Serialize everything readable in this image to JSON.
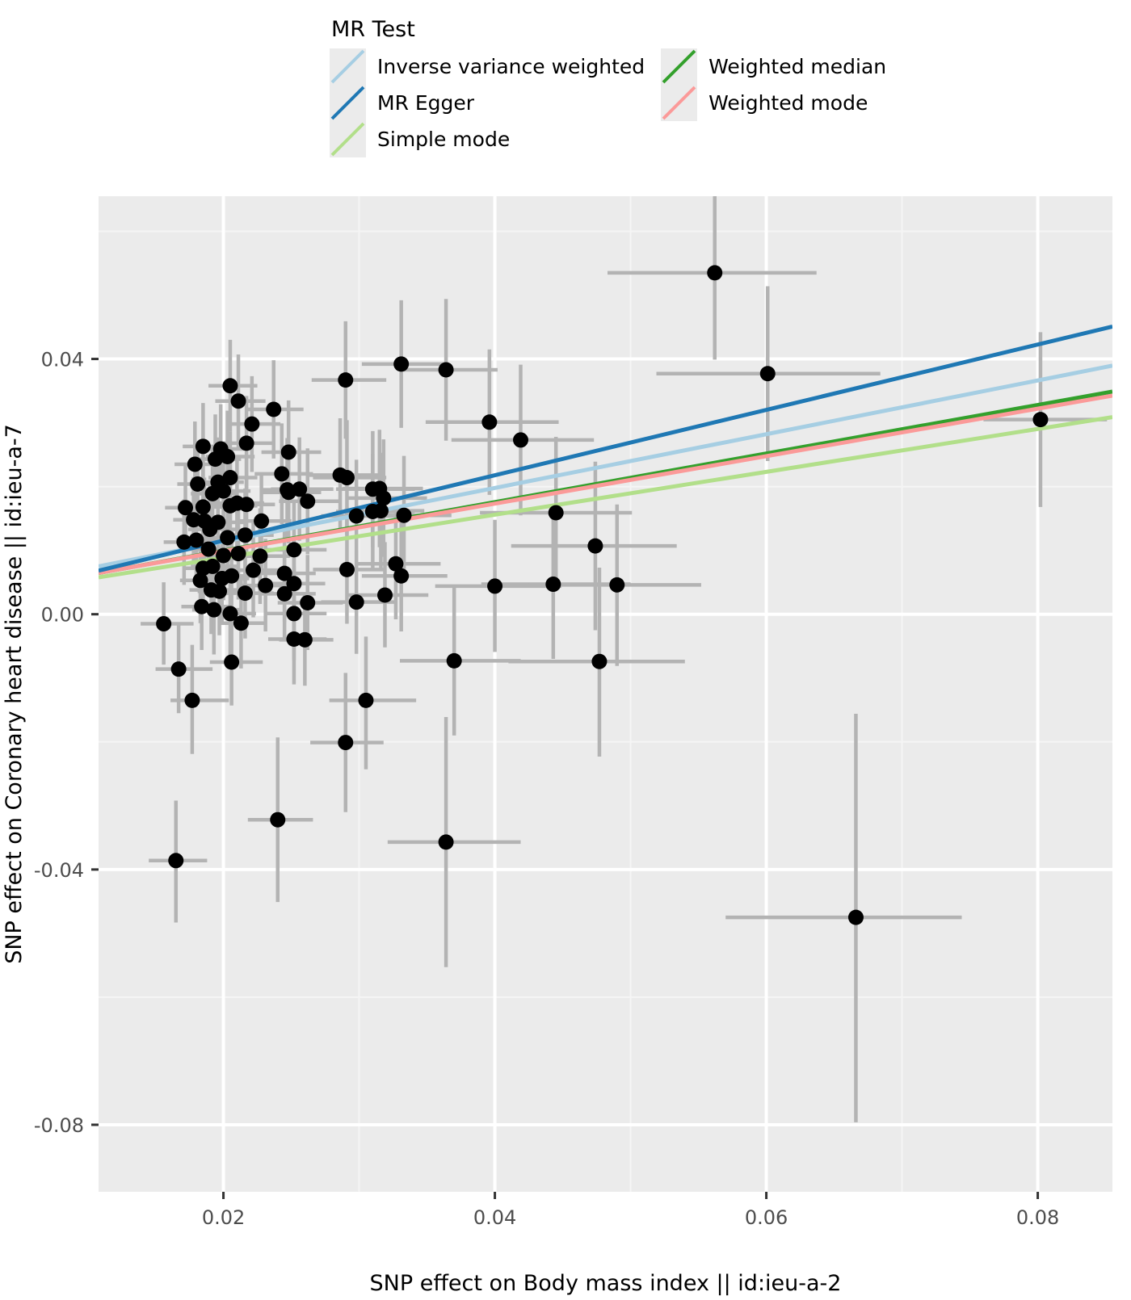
{
  "legend": {
    "title": "MR Test",
    "items": [
      {
        "label": "Inverse variance weighted",
        "color": "#a6cee3",
        "column": 1
      },
      {
        "label": "MR Egger",
        "color": "#1f78b4",
        "column": 1
      },
      {
        "label": "Simple mode",
        "color": "#b2df8a",
        "column": 1
      },
      {
        "label": "Weighted median",
        "color": "#33a02c",
        "column": 2
      },
      {
        "label": "Weighted mode",
        "color": "#fb9a99",
        "column": 2
      }
    ],
    "key_background": "#ebebeb"
  },
  "chart_data": {
    "type": "scatter",
    "title": "",
    "xlabel": "SNP effect on Body mass index || id:ieu-a-2",
    "ylabel": "SNP effect on Coronary heart disease || id:ieu-a-7",
    "xlim": [
      0.0108,
      0.0855
    ],
    "ylim": [
      -0.0905,
      0.0655
    ],
    "xticks": [
      0.02,
      0.04,
      0.06,
      0.08
    ],
    "xtick_labels": [
      "0.02",
      "0.04",
      "0.06",
      "0.08"
    ],
    "yticks": [
      0.04,
      0.0,
      -0.04,
      -0.08
    ],
    "ytick_labels": [
      "0.04",
      "0.00",
      "-0.04",
      "-0.08"
    ],
    "grid": true,
    "panel_background": "#ebebeb",
    "grid_major_color": "#ffffff",
    "grid_minor_color": "#f5f5f5",
    "point_color": "#000000",
    "errorbar_color": "#b3b3b3",
    "legend_position": "top",
    "series": [
      {
        "name": "Weighted median",
        "type": "line",
        "color": "#33a02c",
        "intercept": 0.00235,
        "slope": 0.3805
      },
      {
        "name": "Weighted mode",
        "type": "line",
        "color": "#fb9a99",
        "intercept": 0.00245,
        "slope": 0.372
      },
      {
        "name": "Simple mode",
        "type": "line",
        "color": "#b2df8a",
        "intercept": 0.00215,
        "slope": 0.336
      },
      {
        "name": "Inverse variance weighted",
        "type": "line",
        "color": "#a6cee3",
        "intercept": 0.00295,
        "slope": 0.421
      },
      {
        "name": "MR Egger",
        "type": "line",
        "color": "#1f78b4",
        "intercept": 0.0013,
        "slope": 0.512
      }
    ],
    "points": [
      {
        "x": 0.0165,
        "y": -0.0386,
        "xlo": 0.0145,
        "xhi": 0.0188,
        "ylo": -0.0483,
        "yhi": -0.0292
      },
      {
        "x": 0.024,
        "y": -0.0322,
        "xlo": 0.0218,
        "xhi": 0.0266,
        "ylo": -0.0451,
        "yhi": -0.0193
      },
      {
        "x": 0.0364,
        "y": -0.0357,
        "xlo": 0.0321,
        "xhi": 0.0419,
        "ylo": -0.0553,
        "yhi": -0.0161
      },
      {
        "x": 0.029,
        "y": -0.0201,
        "xlo": 0.0264,
        "xhi": 0.0318,
        "ylo": -0.031,
        "yhi": -0.0092
      },
      {
        "x": 0.0666,
        "y": -0.0475,
        "xlo": 0.057,
        "xhi": 0.0744,
        "ylo": -0.0796,
        "yhi": -0.0156
      },
      {
        "x": 0.0305,
        "y": -0.0135,
        "xlo": 0.0278,
        "xhi": 0.0342,
        "ylo": -0.0243,
        "yhi": -0.0035
      },
      {
        "x": 0.0177,
        "y": -0.0135,
        "xlo": 0.0161,
        "xhi": 0.0204,
        "ylo": -0.0219,
        "yhi": -0.0048
      },
      {
        "x": 0.0167,
        "y": -0.0086,
        "xlo": 0.015,
        "xhi": 0.0192,
        "ylo": -0.0155,
        "yhi": -0.0017
      },
      {
        "x": 0.0206,
        "y": -0.0075,
        "xlo": 0.019,
        "xhi": 0.0229,
        "ylo": -0.0143,
        "yhi": -0.0007
      },
      {
        "x": 0.0252,
        "y": -0.0039,
        "xlo": 0.0233,
        "xhi": 0.0276,
        "ylo": -0.011,
        "yhi": 0.0032
      },
      {
        "x": 0.026,
        "y": -0.004,
        "xlo": 0.0241,
        "xhi": 0.0281,
        "ylo": -0.0112,
        "yhi": 0.0031
      },
      {
        "x": 0.0213,
        "y": -0.0014,
        "xlo": 0.0197,
        "xhi": 0.0232,
        "ylo": -0.0085,
        "yhi": 0.0056
      },
      {
        "x": 0.037,
        "y": -0.0073,
        "xlo": 0.033,
        "xhi": 0.0419,
        "ylo": -0.019,
        "yhi": 0.0044
      },
      {
        "x": 0.0477,
        "y": -0.0074,
        "xlo": 0.041,
        "xhi": 0.054,
        "ylo": -0.0223,
        "yhi": 0.0073
      },
      {
        "x": 0.0156,
        "y": -0.0015,
        "xlo": 0.0139,
        "xhi": 0.0178,
        "ylo": -0.0079,
        "yhi": 0.005
      },
      {
        "x": 0.0184,
        "y": 0.0012,
        "xlo": 0.0169,
        "xhi": 0.0205,
        "ylo": -0.0056,
        "yhi": 0.0081
      },
      {
        "x": 0.0193,
        "y": 0.0007,
        "xlo": 0.0177,
        "xhi": 0.0212,
        "ylo": -0.0063,
        "yhi": 0.0077
      },
      {
        "x": 0.0205,
        "y": 0.0001,
        "xlo": 0.0189,
        "xhi": 0.0224,
        "ylo": -0.0069,
        "yhi": 0.007
      },
      {
        "x": 0.0252,
        "y": 0.0001,
        "xlo": 0.0231,
        "xhi": 0.0276,
        "ylo": -0.0072,
        "yhi": 0.0074
      },
      {
        "x": 0.0262,
        "y": 0.0018,
        "xlo": 0.024,
        "xhi": 0.0288,
        "ylo": -0.0056,
        "yhi": 0.0093
      },
      {
        "x": 0.0298,
        "y": 0.0019,
        "xlo": 0.0272,
        "xhi": 0.0328,
        "ylo": -0.0062,
        "yhi": 0.01
      },
      {
        "x": 0.0319,
        "y": 0.003,
        "xlo": 0.0292,
        "xhi": 0.0351,
        "ylo": -0.0052,
        "yhi": 0.0113
      },
      {
        "x": 0.0443,
        "y": 0.0047,
        "xlo": 0.039,
        "xhi": 0.05,
        "ylo": -0.007,
        "yhi": 0.0163
      },
      {
        "x": 0.049,
        "y": 0.0046,
        "xlo": 0.0425,
        "xhi": 0.0552,
        "ylo": -0.0081,
        "yhi": 0.0172
      },
      {
        "x": 0.04,
        "y": 0.0044,
        "xlo": 0.0356,
        "xhi": 0.0449,
        "ylo": -0.0059,
        "yhi": 0.0148
      },
      {
        "x": 0.0191,
        "y": 0.0038,
        "xlo": 0.0175,
        "xhi": 0.0211,
        "ylo": -0.0031,
        "yhi": 0.0108
      },
      {
        "x": 0.0197,
        "y": 0.0036,
        "xlo": 0.0181,
        "xhi": 0.0217,
        "ylo": -0.0033,
        "yhi": 0.0106
      },
      {
        "x": 0.0216,
        "y": 0.0033,
        "xlo": 0.0199,
        "xhi": 0.0237,
        "ylo": -0.0038,
        "yhi": 0.0104
      },
      {
        "x": 0.0245,
        "y": 0.0032,
        "xlo": 0.0226,
        "xhi": 0.0268,
        "ylo": -0.0042,
        "yhi": 0.0106
      },
      {
        "x": 0.0231,
        "y": 0.0045,
        "xlo": 0.0213,
        "xhi": 0.0252,
        "ylo": -0.0027,
        "yhi": 0.0118
      },
      {
        "x": 0.0252,
        "y": 0.0048,
        "xlo": 0.0232,
        "xhi": 0.0275,
        "ylo": -0.0026,
        "yhi": 0.0122
      },
      {
        "x": 0.0183,
        "y": 0.0053,
        "xlo": 0.0168,
        "xhi": 0.0202,
        "ylo": -0.0014,
        "yhi": 0.0121
      },
      {
        "x": 0.0199,
        "y": 0.0056,
        "xlo": 0.0183,
        "xhi": 0.0219,
        "ylo": -0.0013,
        "yhi": 0.0126
      },
      {
        "x": 0.0206,
        "y": 0.006,
        "xlo": 0.0189,
        "xhi": 0.0226,
        "ylo": -0.001,
        "yhi": 0.013
      },
      {
        "x": 0.0331,
        "y": 0.006,
        "xlo": 0.0302,
        "xhi": 0.0365,
        "ylo": -0.0027,
        "yhi": 0.0148
      },
      {
        "x": 0.0327,
        "y": 0.0079,
        "xlo": 0.0298,
        "xhi": 0.036,
        "ylo": -0.0008,
        "yhi": 0.0167
      },
      {
        "x": 0.0185,
        "y": 0.0072,
        "xlo": 0.017,
        "xhi": 0.0204,
        "ylo": 0.0004,
        "yhi": 0.0141
      },
      {
        "x": 0.0192,
        "y": 0.0075,
        "xlo": 0.0176,
        "xhi": 0.0211,
        "ylo": 0.0006,
        "yhi": 0.0144
      },
      {
        "x": 0.0222,
        "y": 0.0069,
        "xlo": 0.0204,
        "xhi": 0.0243,
        "ylo": -0.0005,
        "yhi": 0.0143
      },
      {
        "x": 0.0245,
        "y": 0.0064,
        "xlo": 0.0226,
        "xhi": 0.0268,
        "ylo": -0.0012,
        "yhi": 0.0141
      },
      {
        "x": 0.0291,
        "y": 0.007,
        "xlo": 0.0266,
        "xhi": 0.032,
        "ylo": -0.0015,
        "yhi": 0.0155
      },
      {
        "x": 0.02,
        "y": 0.0092,
        "xlo": 0.0184,
        "xhi": 0.022,
        "ylo": 0.0022,
        "yhi": 0.0162
      },
      {
        "x": 0.0211,
        "y": 0.0095,
        "xlo": 0.0194,
        "xhi": 0.0231,
        "ylo": 0.0023,
        "yhi": 0.0167
      },
      {
        "x": 0.0227,
        "y": 0.0091,
        "xlo": 0.0209,
        "xhi": 0.0249,
        "ylo": 0.0016,
        "yhi": 0.0166
      },
      {
        "x": 0.0189,
        "y": 0.0102,
        "xlo": 0.0173,
        "xhi": 0.0208,
        "ylo": 0.0033,
        "yhi": 0.0171
      },
      {
        "x": 0.0252,
        "y": 0.0101,
        "xlo": 0.0232,
        "xhi": 0.0276,
        "ylo": 0.0023,
        "yhi": 0.0179
      },
      {
        "x": 0.0474,
        "y": 0.0107,
        "xlo": 0.0412,
        "xhi": 0.0534,
        "ylo": -0.0025,
        "yhi": 0.0239
      },
      {
        "x": 0.0171,
        "y": 0.0113,
        "xlo": 0.0156,
        "xhi": 0.0189,
        "ylo": 0.0046,
        "yhi": 0.018
      },
      {
        "x": 0.018,
        "y": 0.0116,
        "xlo": 0.0165,
        "xhi": 0.0198,
        "ylo": 0.0048,
        "yhi": 0.0184
      },
      {
        "x": 0.0203,
        "y": 0.012,
        "xlo": 0.0187,
        "xhi": 0.0223,
        "ylo": 0.0049,
        "yhi": 0.0191
      },
      {
        "x": 0.0216,
        "y": 0.0124,
        "xlo": 0.0199,
        "xhi": 0.0237,
        "ylo": 0.0051,
        "yhi": 0.0197
      },
      {
        "x": 0.019,
        "y": 0.0133,
        "xlo": 0.0174,
        "xhi": 0.0209,
        "ylo": 0.0064,
        "yhi": 0.0202
      },
      {
        "x": 0.0196,
        "y": 0.0144,
        "xlo": 0.018,
        "xhi": 0.0215,
        "ylo": 0.0075,
        "yhi": 0.0213
      },
      {
        "x": 0.0178,
        "y": 0.0148,
        "xlo": 0.0163,
        "xhi": 0.0196,
        "ylo": 0.0081,
        "yhi": 0.0215
      },
      {
        "x": 0.0186,
        "y": 0.0146,
        "xlo": 0.0171,
        "xhi": 0.0204,
        "ylo": 0.0078,
        "yhi": 0.0214
      },
      {
        "x": 0.0228,
        "y": 0.0146,
        "xlo": 0.021,
        "xhi": 0.025,
        "ylo": 0.0071,
        "yhi": 0.0221
      },
      {
        "x": 0.0298,
        "y": 0.0154,
        "xlo": 0.0272,
        "xhi": 0.0328,
        "ylo": 0.0066,
        "yhi": 0.0242
      },
      {
        "x": 0.031,
        "y": 0.0161,
        "xlo": 0.0283,
        "xhi": 0.0341,
        "ylo": 0.0071,
        "yhi": 0.0251
      },
      {
        "x": 0.0316,
        "y": 0.0162,
        "xlo": 0.0289,
        "xhi": 0.0348,
        "ylo": 0.0071,
        "yhi": 0.0253
      },
      {
        "x": 0.0333,
        "y": 0.0155,
        "xlo": 0.0304,
        "xhi": 0.0368,
        "ylo": 0.0062,
        "yhi": 0.0248
      },
      {
        "x": 0.0445,
        "y": 0.0159,
        "xlo": 0.0389,
        "xhi": 0.0501,
        "ylo": 0.004,
        "yhi": 0.0278
      },
      {
        "x": 0.0172,
        "y": 0.0167,
        "xlo": 0.0157,
        "xhi": 0.019,
        "ylo": 0.01,
        "yhi": 0.0234
      },
      {
        "x": 0.0185,
        "y": 0.0168,
        "xlo": 0.017,
        "xhi": 0.0204,
        "ylo": 0.01,
        "yhi": 0.0236
      },
      {
        "x": 0.0205,
        "y": 0.017,
        "xlo": 0.0188,
        "xhi": 0.0225,
        "ylo": 0.0098,
        "yhi": 0.0242
      },
      {
        "x": 0.021,
        "y": 0.0174,
        "xlo": 0.0193,
        "xhi": 0.023,
        "ylo": 0.0101,
        "yhi": 0.0247
      },
      {
        "x": 0.0217,
        "y": 0.0172,
        "xlo": 0.02,
        "xhi": 0.0238,
        "ylo": 0.0098,
        "yhi": 0.0246
      },
      {
        "x": 0.0262,
        "y": 0.0177,
        "xlo": 0.0241,
        "xhi": 0.0287,
        "ylo": 0.0094,
        "yhi": 0.026
      },
      {
        "x": 0.0318,
        "y": 0.0182,
        "xlo": 0.029,
        "xhi": 0.035,
        "ylo": 0.009,
        "yhi": 0.0274
      },
      {
        "x": 0.0192,
        "y": 0.0189,
        "xlo": 0.0176,
        "xhi": 0.0211,
        "ylo": 0.012,
        "yhi": 0.0258
      },
      {
        "x": 0.02,
        "y": 0.0193,
        "xlo": 0.0184,
        "xhi": 0.022,
        "ylo": 0.0123,
        "yhi": 0.0263
      },
      {
        "x": 0.0248,
        "y": 0.0191,
        "xlo": 0.0228,
        "xhi": 0.0272,
        "ylo": 0.0111,
        "yhi": 0.0271
      },
      {
        "x": 0.0256,
        "y": 0.0196,
        "xlo": 0.0235,
        "xhi": 0.0281,
        "ylo": 0.0115,
        "yhi": 0.0277
      },
      {
        "x": 0.031,
        "y": 0.0196,
        "xlo": 0.0283,
        "xhi": 0.0341,
        "ylo": 0.0105,
        "yhi": 0.0287
      },
      {
        "x": 0.0315,
        "y": 0.0197,
        "xlo": 0.0288,
        "xhi": 0.0347,
        "ylo": 0.0105,
        "yhi": 0.0289
      },
      {
        "x": 0.0181,
        "y": 0.0204,
        "xlo": 0.0166,
        "xhi": 0.0199,
        "ylo": 0.0137,
        "yhi": 0.0271
      },
      {
        "x": 0.0196,
        "y": 0.0207,
        "xlo": 0.018,
        "xhi": 0.0215,
        "ylo": 0.0137,
        "yhi": 0.0277
      },
      {
        "x": 0.0205,
        "y": 0.0214,
        "xlo": 0.0189,
        "xhi": 0.0225,
        "ylo": 0.0142,
        "yhi": 0.0286
      },
      {
        "x": 0.0243,
        "y": 0.022,
        "xlo": 0.0223,
        "xhi": 0.0266,
        "ylo": 0.0141,
        "yhi": 0.0299
      },
      {
        "x": 0.0286,
        "y": 0.0218,
        "xlo": 0.0261,
        "xhi": 0.0315,
        "ylo": 0.0129,
        "yhi": 0.0307
      },
      {
        "x": 0.0179,
        "y": 0.0235,
        "xlo": 0.0164,
        "xhi": 0.0197,
        "ylo": 0.0168,
        "yhi": 0.0302
      },
      {
        "x": 0.0194,
        "y": 0.0243,
        "xlo": 0.0178,
        "xhi": 0.0213,
        "ylo": 0.0173,
        "yhi": 0.0313
      },
      {
        "x": 0.0203,
        "y": 0.0247,
        "xlo": 0.0187,
        "xhi": 0.0223,
        "ylo": 0.0175,
        "yhi": 0.0319
      },
      {
        "x": 0.0248,
        "y": 0.0254,
        "xlo": 0.0228,
        "xhi": 0.0272,
        "ylo": 0.0173,
        "yhi": 0.0335
      },
      {
        "x": 0.0185,
        "y": 0.0263,
        "xlo": 0.017,
        "xhi": 0.0204,
        "ylo": 0.0195,
        "yhi": 0.0331
      },
      {
        "x": 0.0217,
        "y": 0.0268,
        "xlo": 0.02,
        "xhi": 0.0238,
        "ylo": 0.0194,
        "yhi": 0.0342
      },
      {
        "x": 0.0198,
        "y": 0.0259,
        "xlo": 0.0182,
        "xhi": 0.0218,
        "ylo": 0.0189,
        "yhi": 0.0329
      },
      {
        "x": 0.0291,
        "y": 0.0214,
        "xlo": 0.0266,
        "xhi": 0.032,
        "ylo": 0.0124,
        "yhi": 0.0304
      },
      {
        "x": 0.0247,
        "y": 0.0195,
        "xlo": 0.0227,
        "xhi": 0.0271,
        "ylo": 0.0114,
        "yhi": 0.0276
      },
      {
        "x": 0.0419,
        "y": 0.0273,
        "xlo": 0.0368,
        "xhi": 0.0473,
        "ylo": 0.0155,
        "yhi": 0.0391
      },
      {
        "x": 0.0396,
        "y": 0.0301,
        "xlo": 0.0349,
        "xhi": 0.0447,
        "ylo": 0.0187,
        "yhi": 0.0415
      },
      {
        "x": 0.0211,
        "y": 0.0334,
        "xlo": 0.0194,
        "xhi": 0.0231,
        "ylo": 0.0261,
        "yhi": 0.0407
      },
      {
        "x": 0.0221,
        "y": 0.0298,
        "xlo": 0.0204,
        "xhi": 0.0242,
        "ylo": 0.0223,
        "yhi": 0.0373
      },
      {
        "x": 0.0237,
        "y": 0.0321,
        "xlo": 0.0218,
        "xhi": 0.0259,
        "ylo": 0.0244,
        "yhi": 0.0398
      },
      {
        "x": 0.029,
        "y": 0.0367,
        "xlo": 0.0265,
        "xhi": 0.032,
        "ylo": 0.0275,
        "yhi": 0.0459
      },
      {
        "x": 0.0331,
        "y": 0.0392,
        "xlo": 0.0302,
        "xhi": 0.0365,
        "ylo": 0.0292,
        "yhi": 0.0492
      },
      {
        "x": 0.0364,
        "y": 0.0383,
        "xlo": 0.033,
        "xhi": 0.0402,
        "ylo": 0.0272,
        "yhi": 0.0494
      },
      {
        "x": 0.0205,
        "y": 0.0358,
        "xlo": 0.0189,
        "xhi": 0.0225,
        "ylo": 0.0286,
        "yhi": 0.043
      },
      {
        "x": 0.0601,
        "y": 0.0377,
        "xlo": 0.0519,
        "xhi": 0.0684,
        "ylo": 0.024,
        "yhi": 0.0514
      },
      {
        "x": 0.0802,
        "y": 0.0305,
        "xlo": 0.076,
        "xhi": 0.0851,
        "ylo": 0.0168,
        "yhi": 0.0442
      },
      {
        "x": 0.0562,
        "y": 0.0535,
        "xlo": 0.0483,
        "xhi": 0.0637,
        "ylo": 0.0399,
        "yhi": 0.0671
      }
    ]
  }
}
